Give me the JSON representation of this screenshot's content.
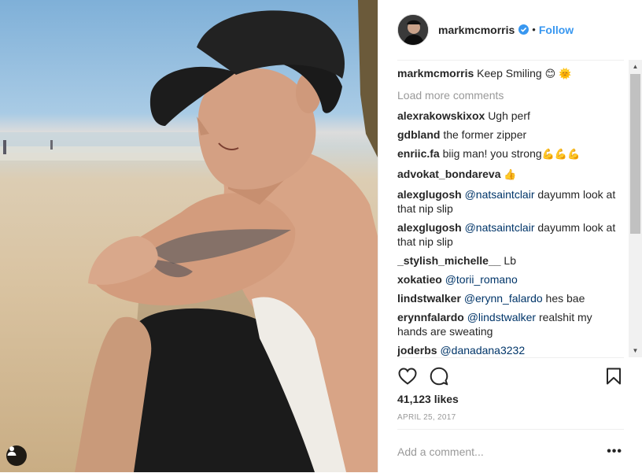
{
  "photo": {
    "alt_icon": "user-tag-icon"
  },
  "post": {
    "username": "markmcmorris",
    "separator": "•",
    "follow_label": "Follow",
    "caption": {
      "user": "markmcmorris",
      "text": "Keep Smiling",
      "emoji": "😊 🌞"
    },
    "load_more": "Load more comments",
    "comments": [
      {
        "user": "alexrakowskixox",
        "text": "Ugh perf"
      },
      {
        "user": "gdbland",
        "text": "the former zipper"
      },
      {
        "user": "enriic.fa",
        "text": "biig man! you strong",
        "emoji": "💪💪💪"
      },
      {
        "user": "advokat_bondareva",
        "text": "",
        "emoji": "👍"
      },
      {
        "user": "alexglugosh",
        "mention": "@natsaintclair",
        "text": "dayumm look at that nip slip"
      },
      {
        "user": "alexglugosh",
        "mention": "@natsaintclair",
        "text": "dayumm look at that nip slip"
      },
      {
        "user": "_stylish_michelle__",
        "text": "Lb"
      },
      {
        "user": "xokatieo",
        "mention": "@torii_romano",
        "text": ""
      },
      {
        "user": "lindstwalker",
        "mention": "@erynn_falardo",
        "text": "hes bae"
      },
      {
        "user": "erynnfalardo",
        "mention": "@lindstwalker",
        "text": "realshit my hands are sweating"
      },
      {
        "user": "joderbs",
        "mention": "@danadana3232",
        "text": ""
      }
    ],
    "likes": "41,123 likes",
    "date": "APRIL 25, 2017",
    "comment_placeholder": "Add a comment...",
    "more_label": "•••"
  },
  "icons": {
    "like": "heart-icon",
    "comment": "speech-bubble-icon",
    "save": "bookmark-icon",
    "verified": "verified-badge-icon"
  },
  "colors": {
    "link": "#3897f0",
    "mention": "#003569",
    "muted": "#999999",
    "text": "#262626"
  }
}
